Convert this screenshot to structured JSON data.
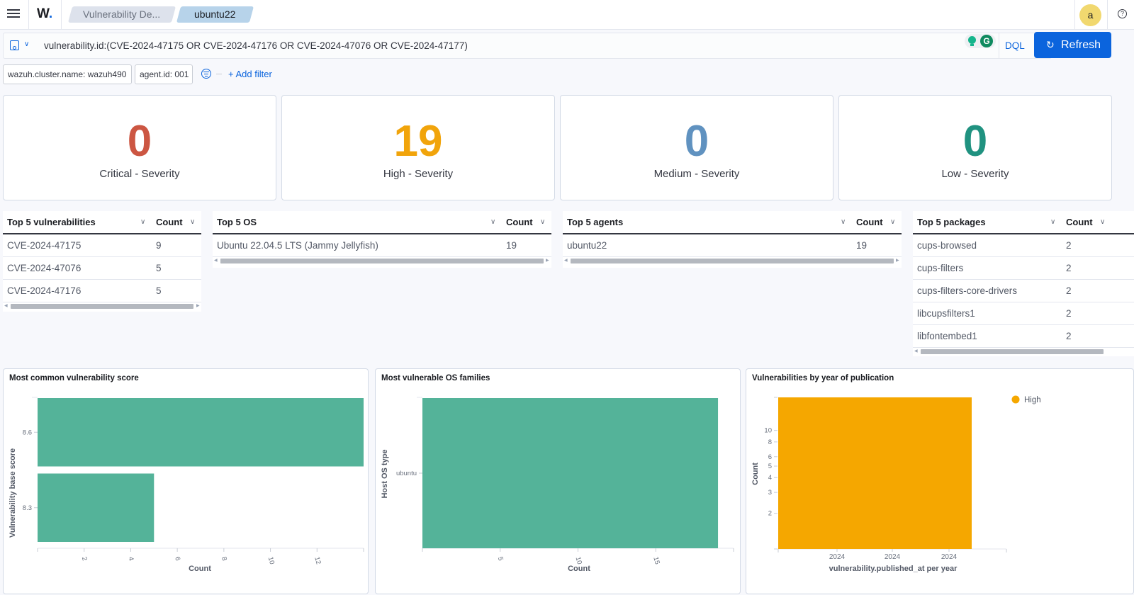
{
  "header": {
    "logo": "W",
    "breadcrumbs": [
      "Vulnerability De...",
      "ubuntu22"
    ],
    "avatar_initial": "a",
    "help_icon": "?"
  },
  "query": {
    "value": "vulnerability.id:(CVE-2024-47175 OR CVE-2024-47176 OR CVE-2024-47076 OR CVE-2024-47177)",
    "language": "DQL",
    "refresh_label": "Refresh",
    "extension_icon_letter": "G"
  },
  "filters": {
    "pills": [
      "wazuh.cluster.name: wazuh490",
      "agent.id: 001"
    ],
    "add_filter_label": "+ Add filter"
  },
  "metrics": [
    {
      "value": "0",
      "label": "Critical - Severity",
      "color": "#cc5642"
    },
    {
      "value": "19",
      "label": "High - Severity",
      "color": "#f1a40b"
    },
    {
      "value": "0",
      "label": "Medium - Severity",
      "color": "#6092c0"
    },
    {
      "value": "0",
      "label": "Low - Severity",
      "color": "#209280"
    }
  ],
  "tables": {
    "vulnerabilities": {
      "header": "Top 5 vulnerabilities",
      "count_header": "Count",
      "rows": [
        {
          "name": "CVE-2024-47175",
          "count": "9"
        },
        {
          "name": "CVE-2024-47076",
          "count": "5"
        },
        {
          "name": "CVE-2024-47176",
          "count": "5"
        }
      ]
    },
    "os": {
      "header": "Top 5 OS",
      "count_header": "Count",
      "rows": [
        {
          "name": "Ubuntu 22.04.5 LTS (Jammy Jellyfish)",
          "count": "19"
        }
      ]
    },
    "agents": {
      "header": "Top 5 agents",
      "count_header": "Count",
      "rows": [
        {
          "name": "ubuntu22",
          "count": "19"
        }
      ]
    },
    "packages": {
      "header": "Top 5 packages",
      "count_header": "Count",
      "rows": [
        {
          "name": "cups-browsed",
          "count": "2"
        },
        {
          "name": "cups-filters",
          "count": "2"
        },
        {
          "name": "cups-filters-core-drivers",
          "count": "2"
        },
        {
          "name": "libcupsfilters1",
          "count": "2"
        },
        {
          "name": "libfontembed1",
          "count": "2"
        }
      ]
    }
  },
  "chart_data": [
    {
      "type": "bar",
      "orientation": "horizontal",
      "title": "Most common vulnerability score",
      "categories": [
        "8.6",
        "8.3"
      ],
      "values": [
        14,
        5
      ],
      "xlabel": "Count",
      "ylabel": "Vulnerability base score",
      "xticks": [
        2,
        4,
        6,
        8,
        10,
        12
      ],
      "xlim": [
        0,
        14
      ],
      "color": "#54b399"
    },
    {
      "type": "bar",
      "orientation": "horizontal",
      "title": "Most vulnerable OS families",
      "categories": [
        "ubuntu"
      ],
      "values": [
        19
      ],
      "xlabel": "Count",
      "ylabel": "Host OS type",
      "xticks": [
        5,
        10,
        15
      ],
      "xlim": [
        0,
        20
      ],
      "color": "#54b399"
    },
    {
      "type": "bar",
      "title": "Vulnerabilities by year of publication",
      "categories": [
        "2024"
      ],
      "series": [
        {
          "name": "High",
          "values": [
            19
          ]
        }
      ],
      "xlabel": "vulnerability.published_at per year",
      "ylabel": "Count",
      "xtick_labels": [
        "2024",
        "2024",
        "2024"
      ],
      "yticks": [
        2,
        3,
        4,
        5,
        6,
        8,
        10
      ],
      "yscale": "log",
      "ylim": [
        1,
        19
      ],
      "legend": "top-right",
      "color": "#f5a700"
    }
  ]
}
